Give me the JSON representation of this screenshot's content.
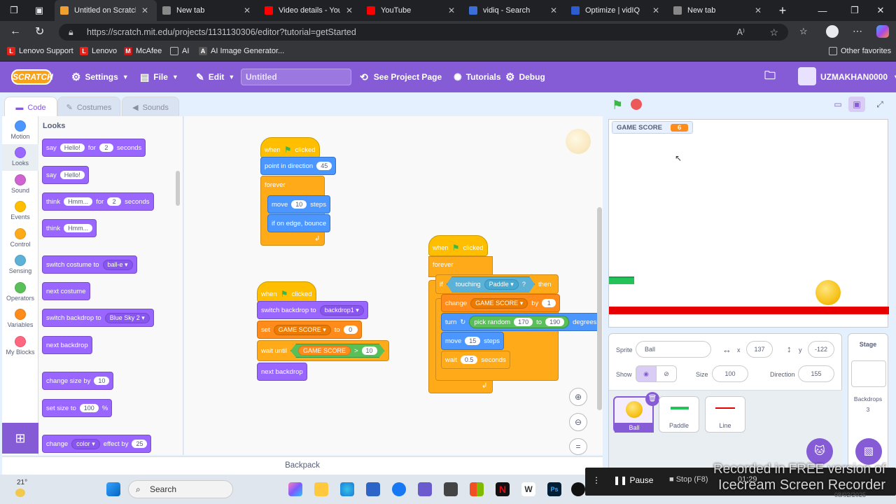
{
  "browser": {
    "tabs": [
      {
        "label": "Untitled on Scratch",
        "active": true,
        "color": "#f0a030"
      },
      {
        "label": "New tab",
        "active": false,
        "color": "#888"
      },
      {
        "label": "Video details - YouTub",
        "active": false,
        "color": "#ff0000"
      },
      {
        "label": "YouTube",
        "active": false,
        "color": "#ff0000"
      },
      {
        "label": "vidiq - Search",
        "active": false,
        "color": "#3b6fd8"
      },
      {
        "label": "Optimize | vidIQ",
        "active": false,
        "color": "#2d5bd0"
      },
      {
        "label": "New tab",
        "active": false,
        "color": "#888"
      }
    ],
    "url": "https://scratch.mit.edu/projects/1131130306/editor?tutorial=getStarted",
    "bookmarks": [
      {
        "label": "Lenovo Support",
        "icon": "L",
        "color": "#e2231a"
      },
      {
        "label": "Lenovo",
        "icon": "L",
        "color": "#e2231a"
      },
      {
        "label": "McAfee",
        "icon": "M",
        "color": "#c01818"
      },
      {
        "label": "AI",
        "icon": "folder",
        "color": "#777"
      },
      {
        "label": "AI Image Generator...",
        "icon": "A",
        "color": "#555"
      }
    ],
    "other_favorites": "Other favorites"
  },
  "menu": {
    "logo": "SCRATCH",
    "settings": "Settings",
    "file": "File",
    "edit": "Edit",
    "title": "Untitled",
    "see_project": "See Project Page",
    "tutorials": "Tutorials",
    "debug": "Debug",
    "username": "UZMAKHAN0000"
  },
  "editor_tabs": {
    "code": "Code",
    "costumes": "Costumes",
    "sounds": "Sounds"
  },
  "categories": [
    {
      "label": "Motion",
      "color": "#4c97ff"
    },
    {
      "label": "Looks",
      "color": "#9966ff"
    },
    {
      "label": "Sound",
      "color": "#cf63cf"
    },
    {
      "label": "Events",
      "color": "#ffbf00"
    },
    {
      "label": "Control",
      "color": "#ffab19"
    },
    {
      "label": "Sensing",
      "color": "#5cb1d6"
    },
    {
      "label": "Operators",
      "color": "#59c059"
    },
    {
      "label": "Variables",
      "color": "#ff8c1a"
    },
    {
      "label": "My Blocks",
      "color": "#ff6680"
    }
  ],
  "palette": {
    "heading": "Looks",
    "say_for": {
      "a": "say",
      "v1": "Hello!",
      "b": "for",
      "v2": "2",
      "c": "seconds"
    },
    "say": {
      "a": "say",
      "v1": "Hello!"
    },
    "think_for": {
      "a": "think",
      "v1": "Hmm...",
      "b": "for",
      "v2": "2",
      "c": "seconds"
    },
    "think": {
      "a": "think",
      "v1": "Hmm..."
    },
    "switch_costume": {
      "a": "switch costume to",
      "v1": "ball-e"
    },
    "next_costume": "next costume",
    "switch_backdrop": {
      "a": "switch backdrop to",
      "v1": "Blue Sky 2"
    },
    "next_backdrop": "next backdrop",
    "change_size": {
      "a": "change size by",
      "v1": "10"
    },
    "set_size": {
      "a": "set size to",
      "v1": "100",
      "b": "%"
    },
    "change_effect": {
      "a": "change",
      "v1": "color",
      "b": "effect by",
      "v2": "25"
    }
  },
  "scripts": {
    "s1": {
      "when": "when",
      "clicked": "clicked",
      "point": "point in direction",
      "point_v": "45",
      "forever": "forever",
      "move": "move",
      "move_v": "10",
      "steps": "steps",
      "bounce": "if on edge, bounce"
    },
    "s2": {
      "when": "when",
      "clicked": "clicked",
      "switch": "switch backdrop to",
      "switch_v": "backdrop1",
      "set": "set",
      "set_var": "GAME SCORE",
      "to": "to",
      "set_v": "0",
      "wait_until": "wait until",
      "cmp_var": "GAME SCORE",
      "gt": ">",
      "cmp_v": "10",
      "next": "next backdrop"
    },
    "s3": {
      "when": "when",
      "clicked": "clicked",
      "forever": "forever",
      "if": "if",
      "touching": "touching",
      "touching_v": "Paddle",
      "q": "?",
      "then": "then",
      "change": "change",
      "change_var": "GAME SCORE",
      "by": "by",
      "change_v": "1",
      "turn": "turn",
      "pick": "pick random",
      "r1": "170",
      "to": "to",
      "r2": "190",
      "degrees": "degrees",
      "move": "move",
      "move_v": "15",
      "steps": "steps",
      "wait": "wait",
      "wait_v": "0.5",
      "seconds": "seconds"
    }
  },
  "stage": {
    "monitor_label": "GAME SCORE",
    "monitor_value": "6"
  },
  "sprite_info": {
    "sprite_label": "Sprite",
    "sprite_name": "Ball",
    "x_label": "x",
    "x": "137",
    "y_label": "y",
    "y": "-122",
    "show_label": "Show",
    "size_label": "Size",
    "size": "100",
    "direction_label": "Direction",
    "direction": "155"
  },
  "sprites": [
    {
      "name": "Ball"
    },
    {
      "name": "Paddle"
    },
    {
      "name": "Line"
    }
  ],
  "stage_pane": {
    "title": "Stage",
    "backdrops_label": "Backdrops",
    "backdrops_count": "3"
  },
  "backpack": "Backpack",
  "recorder": {
    "pause": "Pause",
    "stop": "Stop (F8)",
    "time": "01:29",
    "watermark_line1": "Recorded in FREE version of",
    "watermark_line2": "Icecream Screen Recorder"
  },
  "taskbar": {
    "weather": "21°",
    "search": "Search",
    "date": "08/02/2025"
  }
}
